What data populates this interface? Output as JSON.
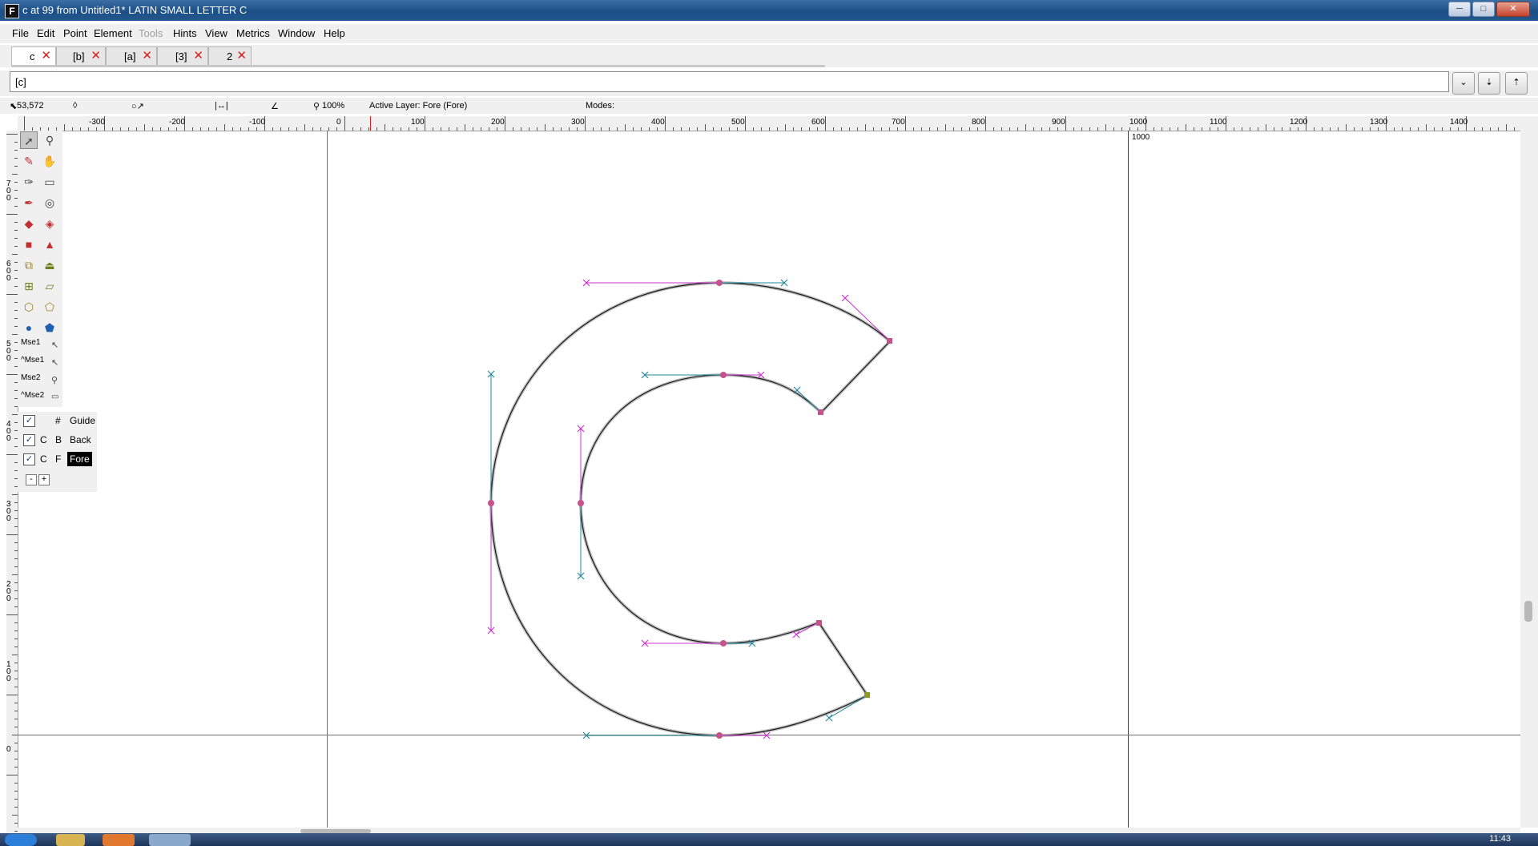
{
  "window": {
    "title": "c at 99 from Untitled1* LATIN SMALL LETTER C",
    "app_icon": "fontforge-icon",
    "minimize": "─",
    "maximize": "□",
    "close": "✕"
  },
  "menu": [
    "File",
    "Edit",
    "Point",
    "Element",
    "Tools",
    "Hints",
    "View",
    "Metrics",
    "Window",
    "Help"
  ],
  "tabs": [
    {
      "label": "c",
      "active": true
    },
    {
      "label": "[b]",
      "active": false
    },
    {
      "label": "[a]",
      "active": false
    },
    {
      "label": "[3]",
      "active": false
    },
    {
      "label": "2",
      "active": false
    }
  ],
  "tab_close_glyph": "✕",
  "char_input": {
    "value": "[c]"
  },
  "char_buttons": [
    "⌄",
    "⇣",
    "⇡"
  ],
  "info": {
    "coords": "53,572",
    "zoom": "100%",
    "active_layer": "Active Layer: Fore (Fore)",
    "modes": "Modes:"
  },
  "hruler_labels": [
    "-300",
    "-200",
    "-100",
    "0",
    "100",
    "200",
    "300",
    "400",
    "500",
    "600",
    "700",
    "800",
    "900",
    "1000",
    "1100",
    "1200",
    "1300",
    "1400"
  ],
  "vruler_labels": [
    "700",
    "600",
    "500",
    "400",
    "300",
    "200",
    "100",
    "0"
  ],
  "advance_label": "1000",
  "toolbox": {
    "tools": [
      [
        "pointer-icon",
        "magnify-icon"
      ],
      [
        "freehand-icon",
        "scroll-hand-icon"
      ],
      [
        "knife-icon",
        "ruler-icon"
      ],
      [
        "pen-icon",
        "spiro-icon"
      ],
      [
        "curve-point-icon",
        "hv-curve-point-icon"
      ],
      [
        "corner-point-icon",
        "tangent-point-icon"
      ],
      [
        "scale-icon",
        "flip-icon"
      ],
      [
        "rotate-icon",
        "skew-icon"
      ],
      [
        "3d-rotate-icon",
        "perspective-icon"
      ],
      [
        "ellipse-icon",
        "polygon-icon"
      ]
    ],
    "mouse": [
      "Mse1",
      "^Mse1",
      "Mse2",
      "^Mse2"
    ]
  },
  "layers": [
    {
      "visible": true,
      "c": "",
      "tag": "#",
      "name": "Guide",
      "selected": false
    },
    {
      "visible": true,
      "c": "C",
      "tag": "B",
      "name": "Back",
      "selected": false
    },
    {
      "visible": true,
      "c": "C",
      "tag": "F",
      "name": "Fore",
      "selected": true
    }
  ],
  "layer_buttons": [
    "-",
    "+"
  ],
  "taskbar": {
    "clock": "11:43"
  },
  "colors": {
    "outline": "#1a1a1a",
    "on_curve_point": "#c8508c",
    "cp_next": "#cc33cc",
    "cp_prev": "#22889a",
    "guide_line": "#606060"
  }
}
